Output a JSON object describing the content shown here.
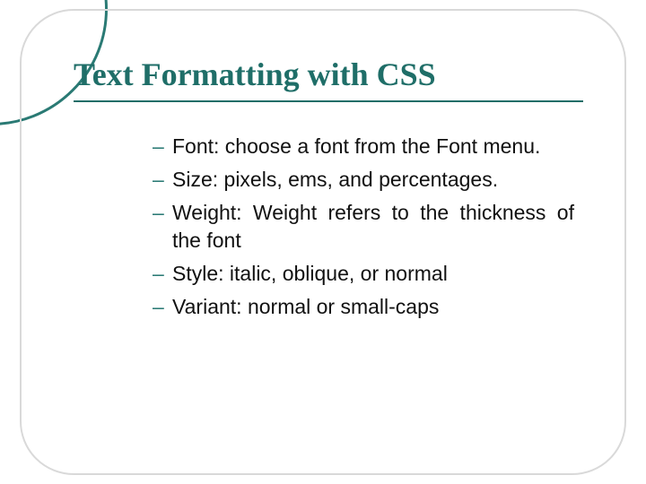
{
  "colors": {
    "accent": "#1f6e68",
    "ring": "#2a7a74",
    "frame": "#d9d9d9",
    "text": "#111111"
  },
  "slide": {
    "title": "Text Formatting with CSS",
    "bullets": [
      "Font: choose a font from the Font menu.",
      "Size: pixels, ems, and percentages.",
      "Weight: Weight refers to the thickness of the font",
      "Style: italic, oblique, or normal",
      "Variant: normal or  small-caps"
    ]
  }
}
